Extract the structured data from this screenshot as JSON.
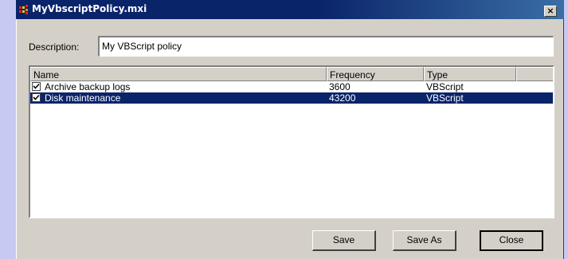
{
  "window": {
    "title": "MyVbscriptPolicy.mxi",
    "close_glyph": "×",
    "icon": "app-icon",
    "colors": {
      "titlebar_start": "#0a246a",
      "titlebar_end": "#3a6ea5",
      "face": "#d4d0c8",
      "desktop": "#c8c9f2",
      "selection": "#0a246a"
    }
  },
  "description": {
    "label": "Description:",
    "value": "My VBScript policy"
  },
  "list": {
    "columns": [
      "Name",
      "Frequency",
      "Type",
      ""
    ],
    "rows": [
      {
        "checked": true,
        "name": "Archive backup logs",
        "frequency": "3600",
        "type": "VBScript",
        "selected": false
      },
      {
        "checked": true,
        "name": "Disk maintenance",
        "frequency": "43200",
        "type": "VBScript",
        "selected": true
      }
    ]
  },
  "buttons": {
    "save": "Save",
    "save_as": "Save As",
    "close": "Close"
  }
}
